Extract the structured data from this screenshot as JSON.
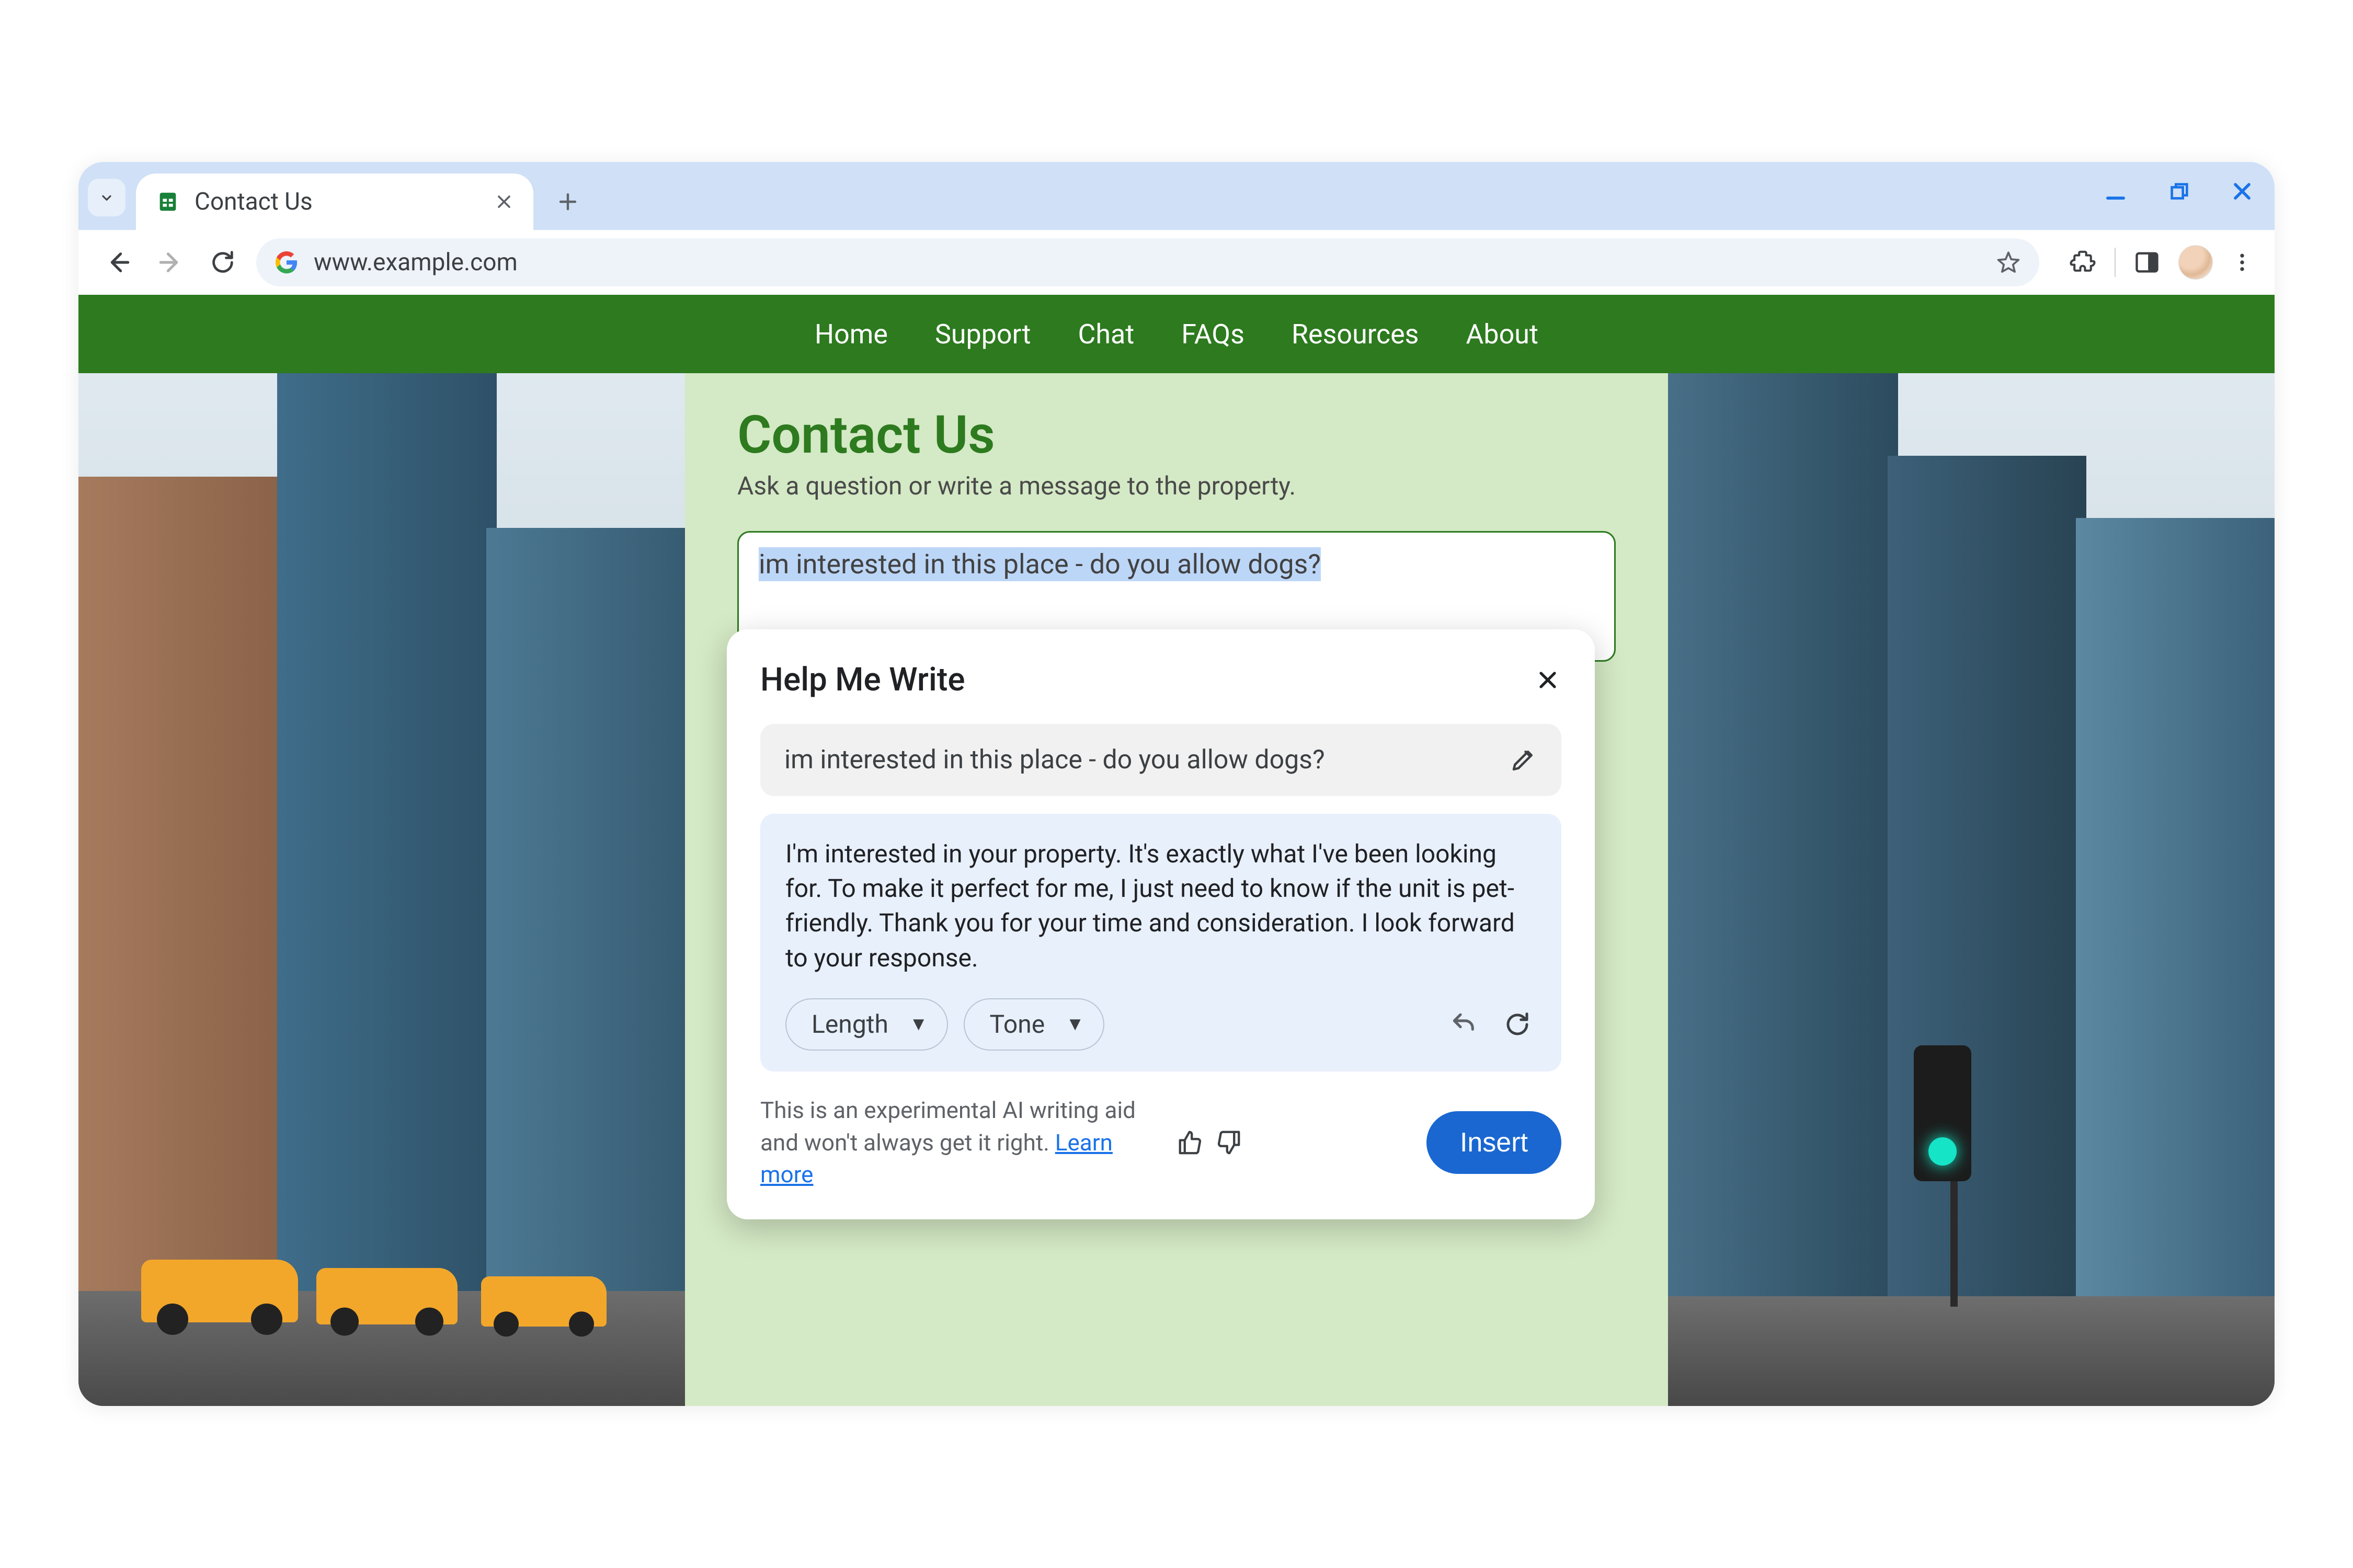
{
  "browser": {
    "tab_title": "Contact Us",
    "url": "www.example.com"
  },
  "nav": {
    "items": [
      "Home",
      "Support",
      "Chat",
      "FAQs",
      "Resources",
      "About"
    ]
  },
  "page": {
    "heading": "Contact Us",
    "subtitle": "Ask a question or write a message to the property.",
    "message_value": "im interested in this place - do you allow dogs?"
  },
  "hmw": {
    "title": "Help Me Write",
    "prompt": "im interested in this place - do you allow dogs?",
    "result": "I'm interested in your property. It's exactly what I've been looking for. To make it perfect for me, I just need to know if the unit is pet-friendly. Thank you for your time and consideration. I look forward to your response.",
    "length_label": "Length",
    "tone_label": "Tone",
    "disclaimer_a": "This is an experimental AI writing aid and won't always get it right. ",
    "learn_more": "Learn more",
    "insert_label": "Insert"
  }
}
